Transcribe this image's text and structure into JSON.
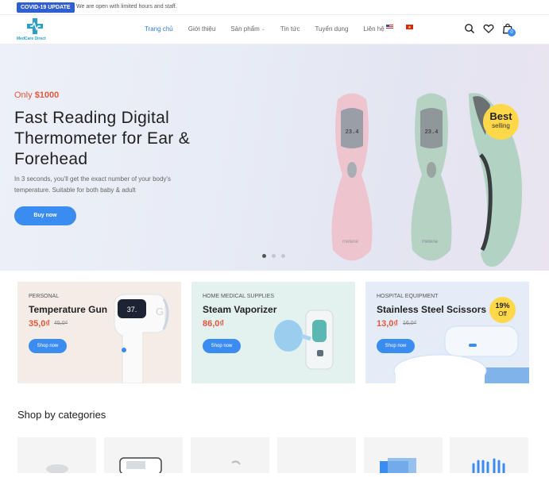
{
  "topbar": {
    "badge": "COVID-19 UPDATE",
    "message": "We are open with limited hours and staff."
  },
  "header": {
    "logo_text": "MedCare Direct",
    "nav": [
      {
        "label": "Trang chủ",
        "active": true
      },
      {
        "label": "Giới thiệu"
      },
      {
        "label": "Sản phẩm"
      },
      {
        "label": "Tin tức"
      },
      {
        "label": "Tuyển dụng"
      },
      {
        "label": "Liên hệ"
      }
    ],
    "cart_count": "0"
  },
  "hero": {
    "only_prefix": "Only",
    "price": "$1000",
    "title": "Fast Reading Digital Thermometer for Ear & Forehead",
    "description": "In 3 seconds, you'll get the exact number of your body's temperature. Suitable for both baby & adult",
    "button": "Buy now",
    "badge_line1": "Best",
    "badge_line2": "selling",
    "product_display": "23.4",
    "brand": "metene"
  },
  "promos": [
    {
      "category": "Personal",
      "name": "Temperature Gun",
      "price": "35,0₫",
      "old_price": "45,0₫",
      "button": "Shop now",
      "bg": "#f4ece6",
      "display": "37."
    },
    {
      "category": "Home Medical Supplies",
      "name": "Steam Vaporizer",
      "price": "86,0₫",
      "old_price": "",
      "button": "Shop now",
      "bg": "#e3f1ef"
    },
    {
      "category": "Hospital Equipment",
      "name": "Stainless Steel Scissors",
      "price": "13,0₫",
      "old_price": "16,0₫",
      "button": "Shop now",
      "bg": "#e4ecf7",
      "discount_pct": "19%",
      "discount_label": "Off"
    }
  ],
  "section_title": "Shop by categories",
  "colors": {
    "accent": "#3b8cf0",
    "price": "#e2583e",
    "badge": "#ffd84a",
    "brand": "#2f5fd0"
  }
}
